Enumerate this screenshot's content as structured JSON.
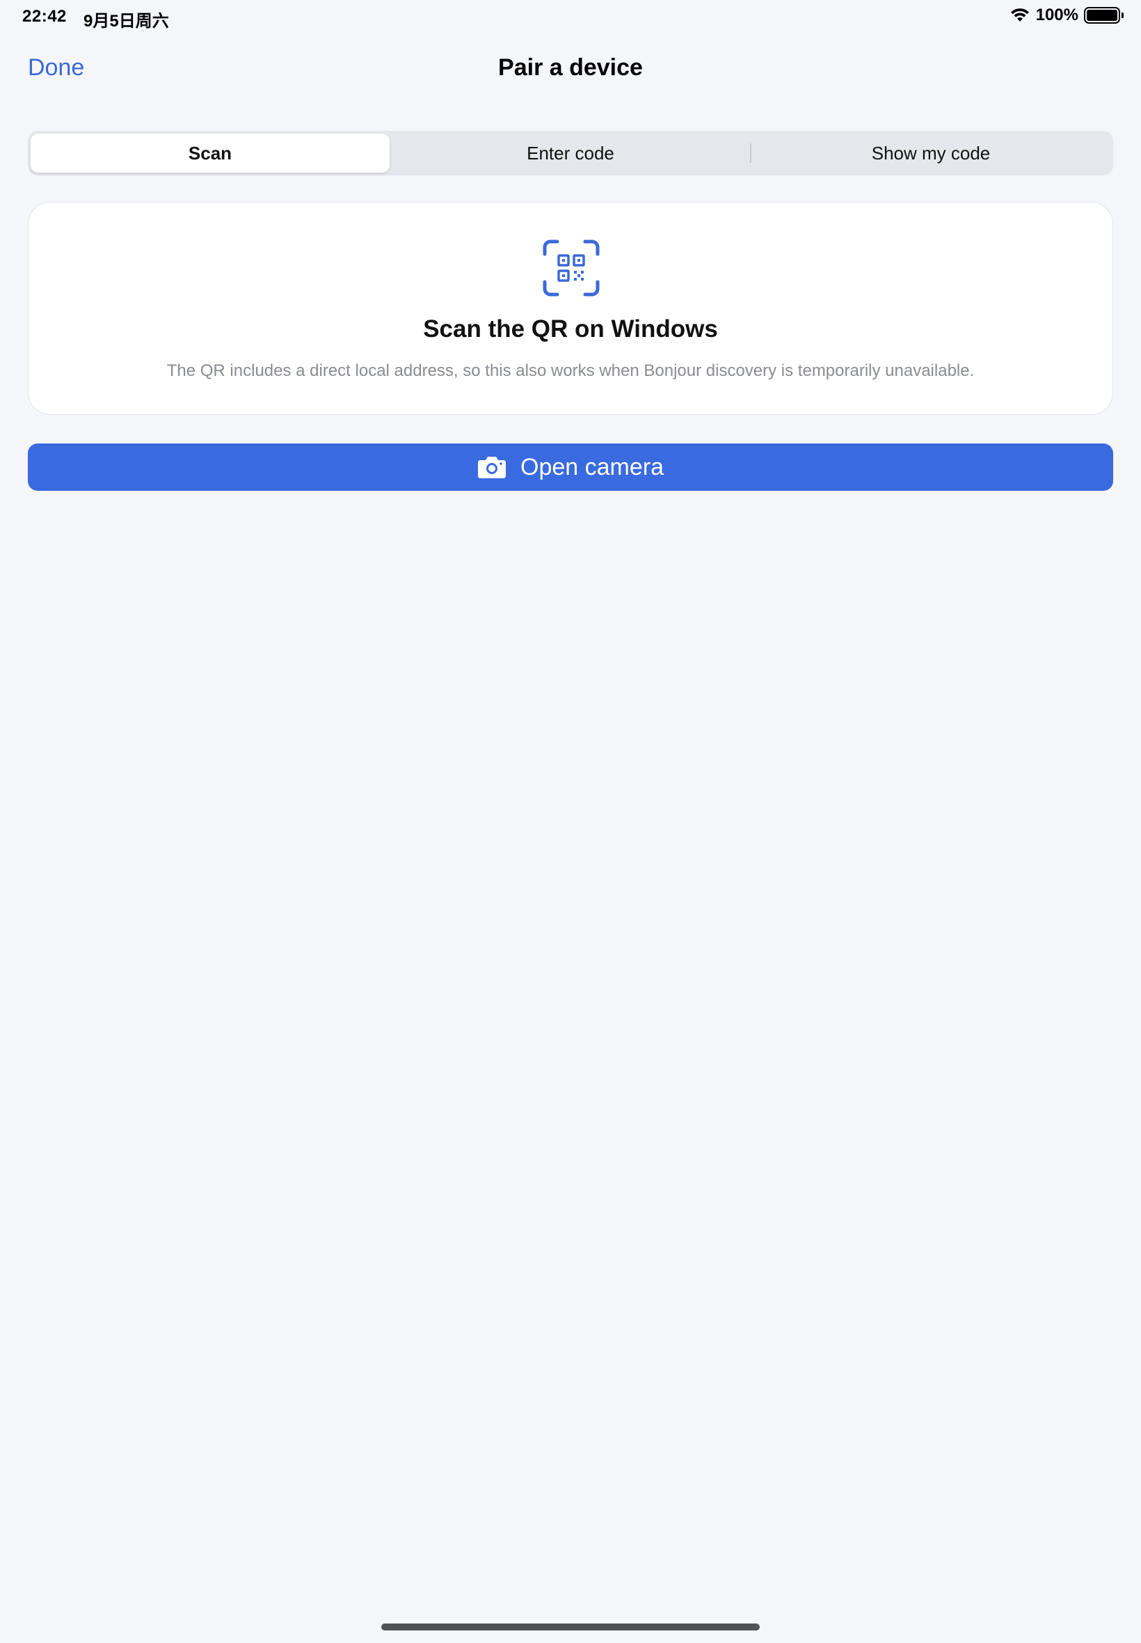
{
  "status_bar": {
    "time": "22:42",
    "date": "9月5日周六",
    "battery_percent": "100%",
    "wifi_icon": "wifi-icon",
    "battery_icon": "battery-icon"
  },
  "nav": {
    "done_label": "Done",
    "title": "Pair a device"
  },
  "segments": {
    "scan": "Scan",
    "enter_code": "Enter code",
    "show_my_code": "Show my code",
    "selected": "Scan"
  },
  "card": {
    "icon": "qr-code-scan-icon",
    "title": "Scan the QR on Windows",
    "description": "The QR includes a direct local address, so this also works when Bonjour discovery is temporarily unavailable."
  },
  "primary_button": {
    "icon": "camera-icon",
    "label": "Open camera"
  },
  "colors": {
    "accent": "#3a6ae0",
    "link": "#3a6ad8",
    "background": "#f5f6fa",
    "secondary_text": "#8a8c92"
  }
}
